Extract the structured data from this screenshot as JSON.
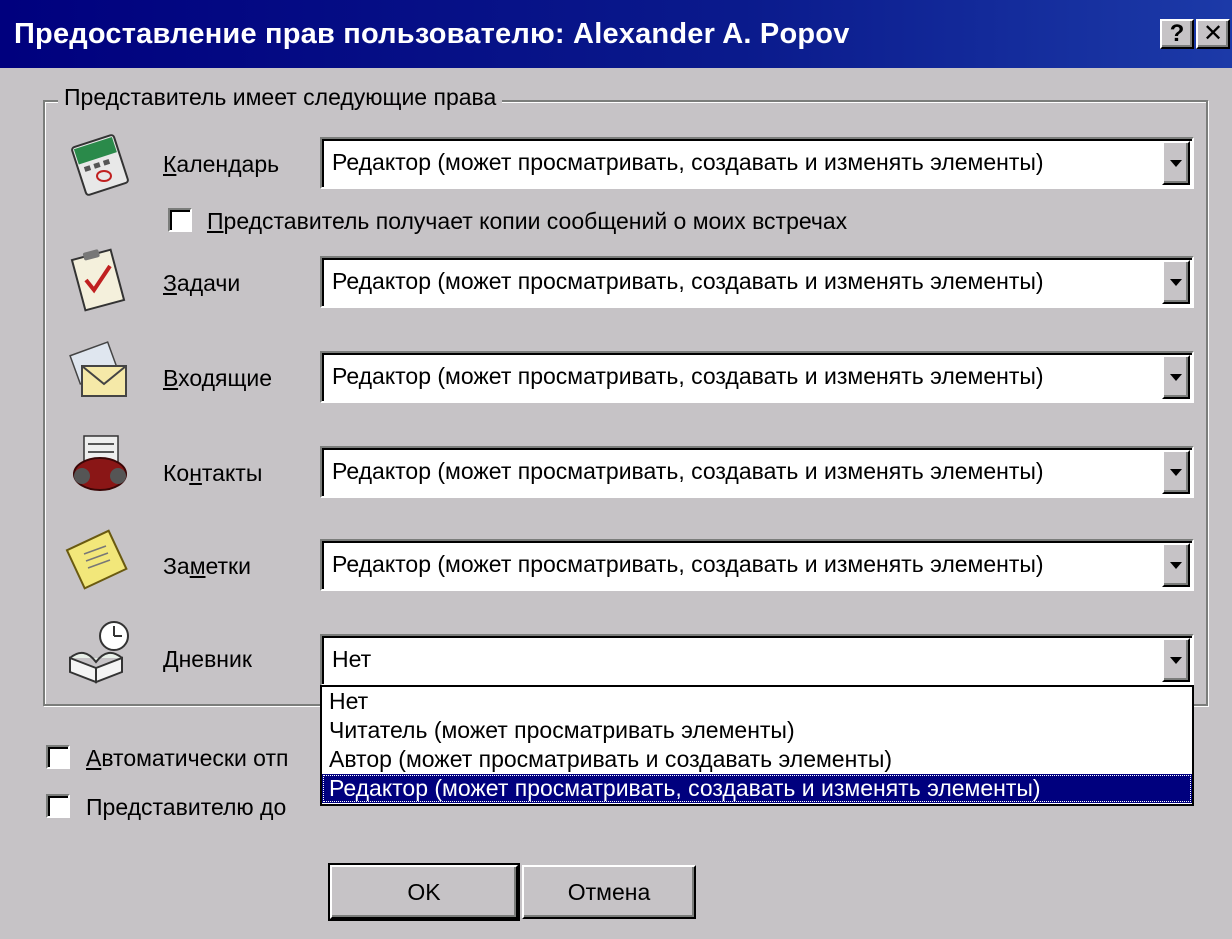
{
  "window": {
    "title": "Предоставление прав пользователю: Alexander A. Popov",
    "help_glyph": "?",
    "close_glyph": "✕"
  },
  "group": {
    "legend": "Представитель имеет следующие права"
  },
  "rows": [
    {
      "label_first": "К",
      "label_rest": "алендарь",
      "value": "Редактор (может просматривать, создавать и изменять элементы)",
      "icon": "calendar-icon"
    },
    {
      "label_first": "З",
      "label_rest": "адачи",
      "value": "Редактор (может просматривать, создавать и изменять элементы)",
      "icon": "tasks-icon"
    },
    {
      "label_first": "В",
      "label_rest": "ходящие",
      "value": "Редактор (может просматривать, создавать и изменять элементы)",
      "icon": "inbox-icon"
    },
    {
      "label_first": "Ко",
      "label_mid": "н",
      "label_rest": "такты",
      "value": "Редактор (может просматривать, создавать и изменять элементы)",
      "icon": "contacts-icon"
    },
    {
      "label_first": "За",
      "label_mid": "м",
      "label_rest": "етки",
      "value": "Редактор (может просматривать, создавать и изменять элементы)",
      "icon": "notes-icon"
    },
    {
      "label_first": "Д",
      "label_rest": "невник",
      "value": "Нет",
      "icon": "journal-icon"
    }
  ],
  "calendar_copy_checkbox": {
    "label_first": "П",
    "label_rest": "редставитель получает копии сообщений о моих встречах",
    "checked": false
  },
  "dropdown_options": [
    "Нет",
    "Читатель (может просматривать элементы)",
    "Автор (может просматривать и создавать элементы)",
    "Редактор (может просматривать, создавать и изменять элементы)"
  ],
  "dropdown_selected_index": 3,
  "auto_send_checkbox": {
    "label_first": "А",
    "label_rest": "втоматически отп",
    "checked": false
  },
  "private_checkbox": {
    "label": "Представителю до",
    "checked": false
  },
  "buttons": {
    "ok": "OK",
    "cancel": "Отмена"
  },
  "colors": {
    "title_bar": "#00007e",
    "dialog_bg": "#c6c3c6",
    "selection": "#00007e"
  }
}
